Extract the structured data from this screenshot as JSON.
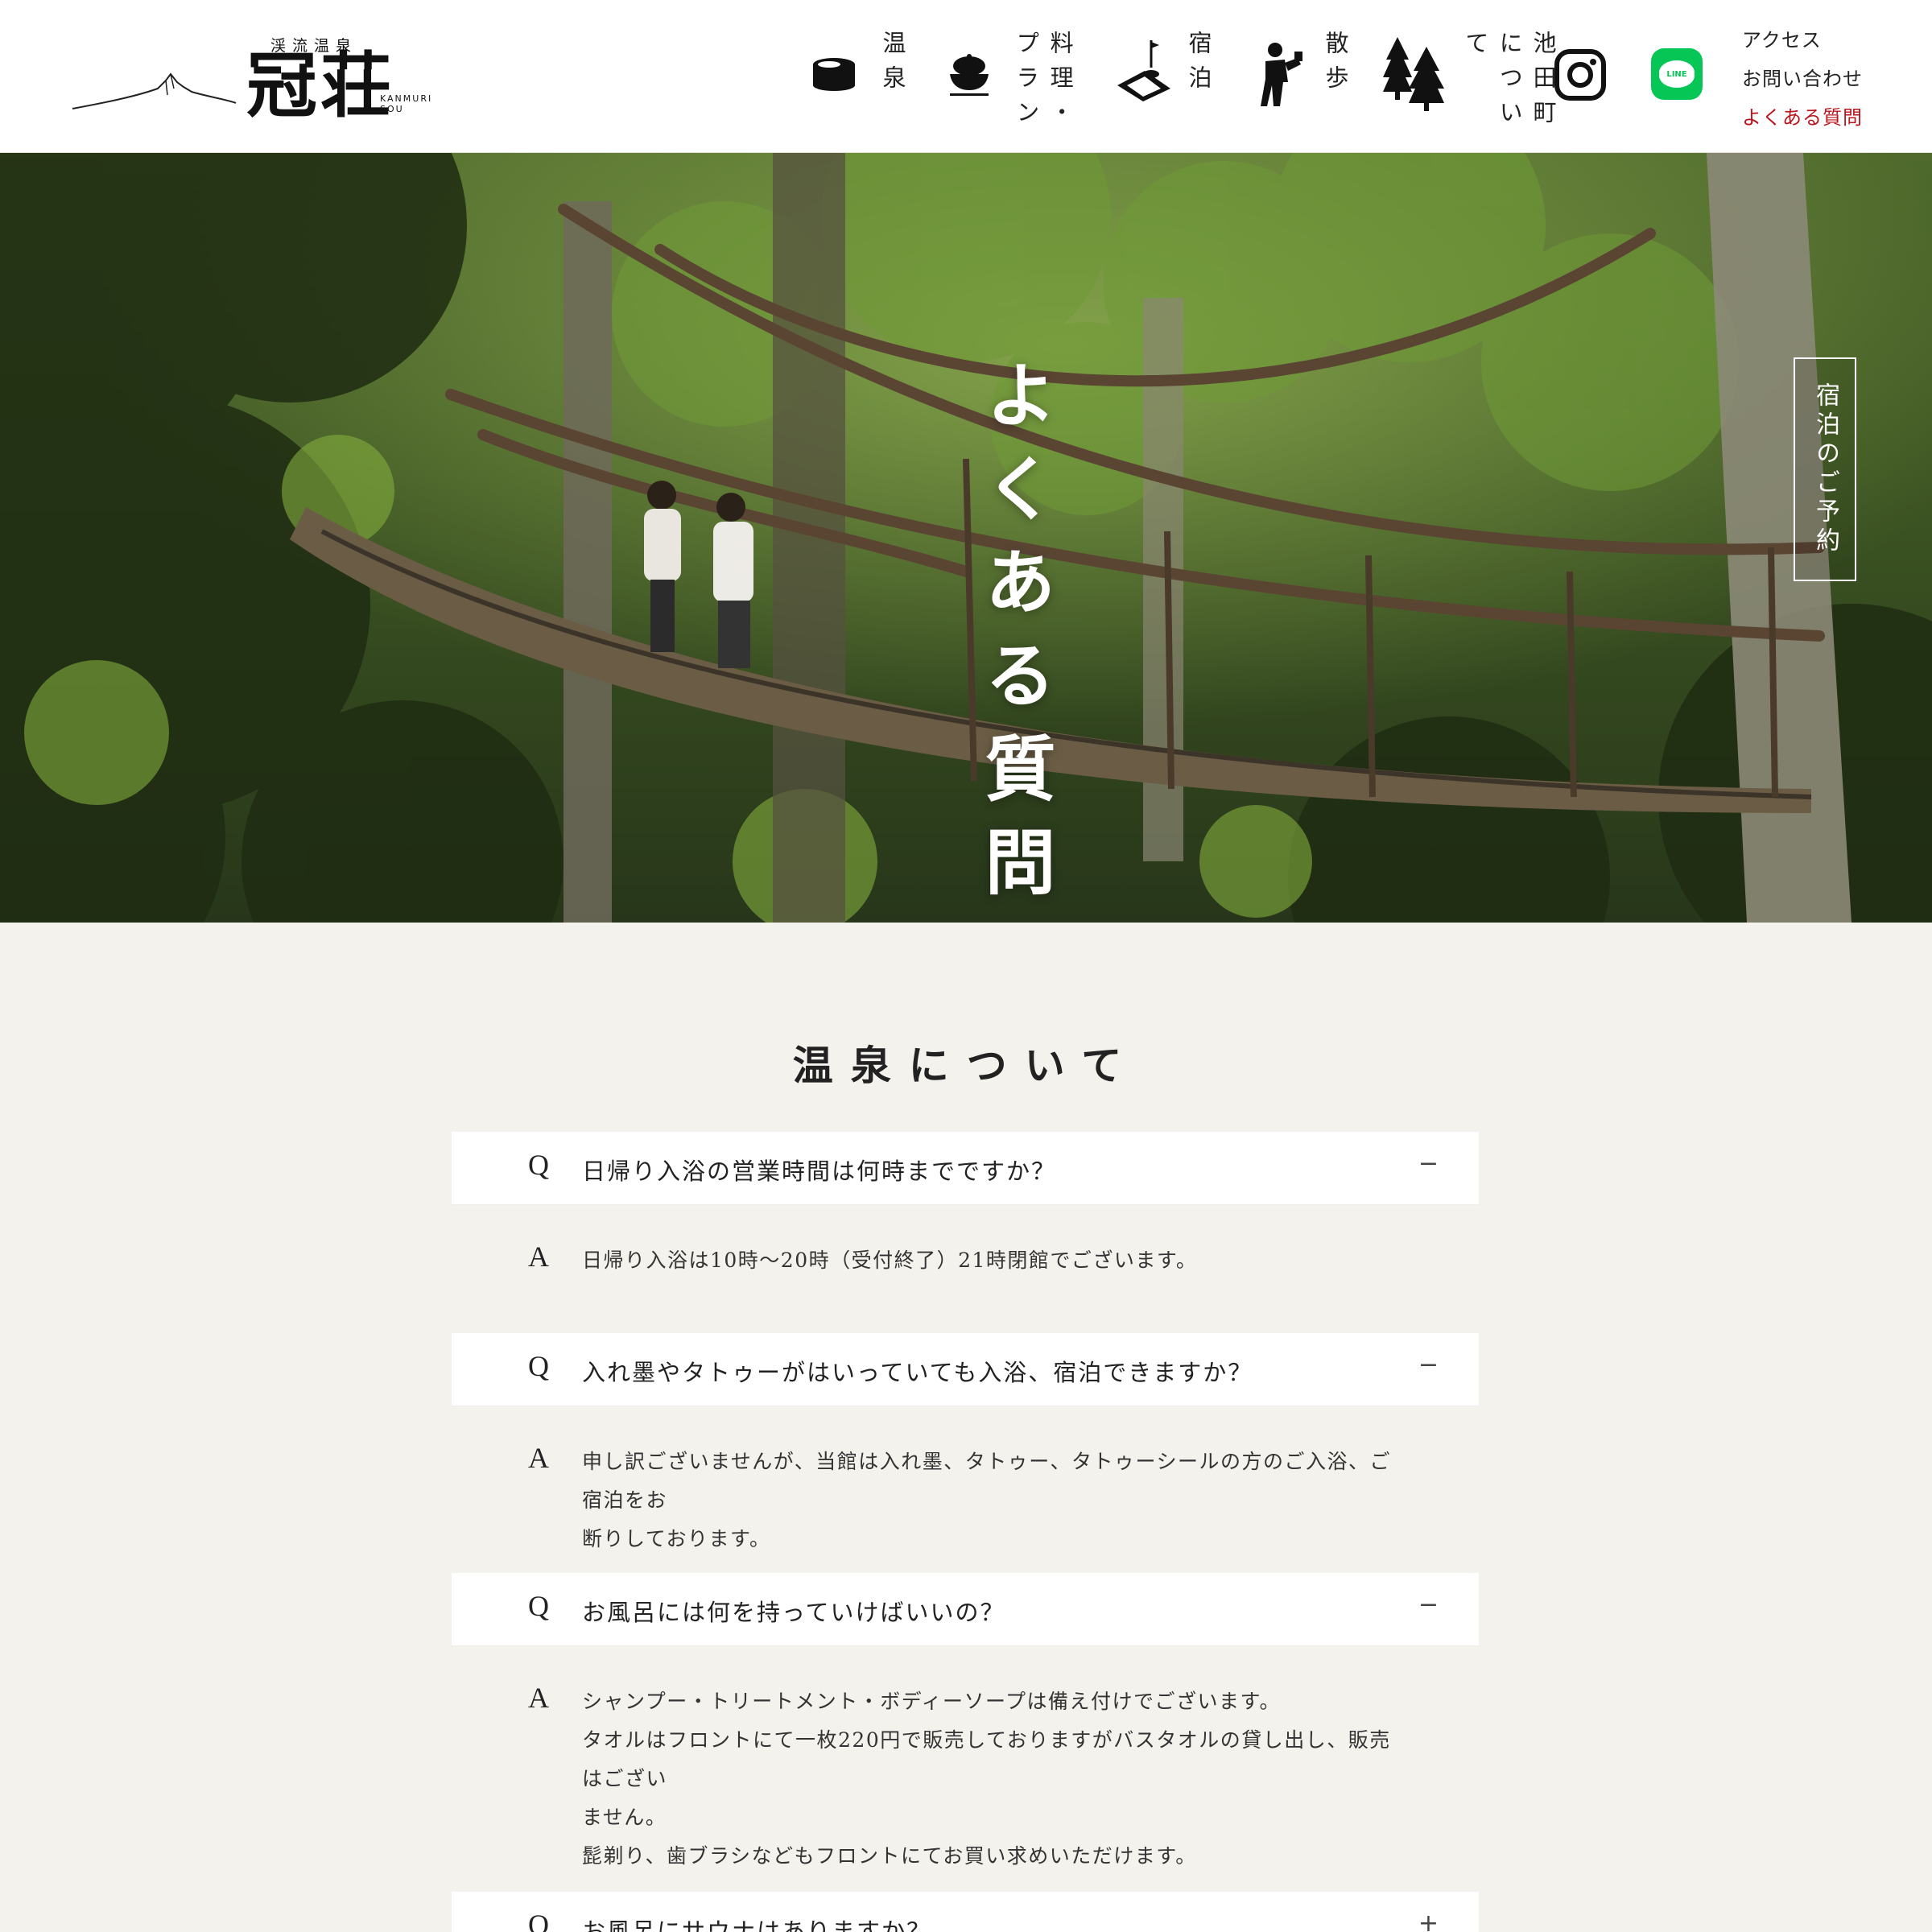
{
  "header": {
    "brand_small": "渓流温泉",
    "brand_main": "冠荘",
    "brand_roman": "KANMURI SOU",
    "nav": [
      {
        "label": "温泉",
        "icon": "onsen-bucket-icon"
      },
      {
        "label": "料理・プラン",
        "icon": "rice-bowl-icon"
      },
      {
        "label": "宿泊",
        "icon": "futon-icon"
      },
      {
        "label": "散歩",
        "icon": "hiker-icon"
      },
      {
        "label": "池田町について",
        "icon": "trees-icon"
      }
    ],
    "instagram_icon": "instagram-icon",
    "line_icon": "line-icon",
    "line_text": "LINE",
    "util_links": {
      "access": "アクセス",
      "contact": "お問い合わせ",
      "faq": "よくある質問"
    },
    "accent_color": "#b8161d"
  },
  "hero": {
    "title": "よくある質問",
    "reserve_label": "宿泊のご予約"
  },
  "section": {
    "title": "温泉について"
  },
  "faqs": [
    {
      "q_mark": "Q",
      "question": "日帰り入浴の営業時間は何時までですか？",
      "toggle": "−",
      "a_mark": "A",
      "answer": [
        "日帰り入浴は10時〜20時（受付終了）21時閉館でございます。"
      ]
    },
    {
      "q_mark": "Q",
      "question": "入れ墨やタトゥーがはいっていても入浴、宿泊できますか？",
      "toggle": "−",
      "a_mark": "A",
      "answer": [
        "申し訳ございませんが、当館は入れ墨、タトゥー、タトゥーシールの方のご入浴、ご宿泊をお",
        "断りしております。"
      ]
    },
    {
      "q_mark": "Q",
      "question": "お風呂には何を持っていけばいいの？",
      "toggle": "−",
      "a_mark": "A",
      "answer": [
        "シャンプー・トリートメント・ボディーソープは備え付けでございます。",
        "タオルはフロントにて一枚220円で販売しておりますがバスタオルの貸し出し、販売はござい",
        "ません。",
        "髭剃り、歯ブラシなどもフロントにてお買い求めいただけます。"
      ]
    },
    {
      "q_mark": "Q",
      "question": "お風呂にサウナはありますか？",
      "toggle": "+"
    }
  ]
}
